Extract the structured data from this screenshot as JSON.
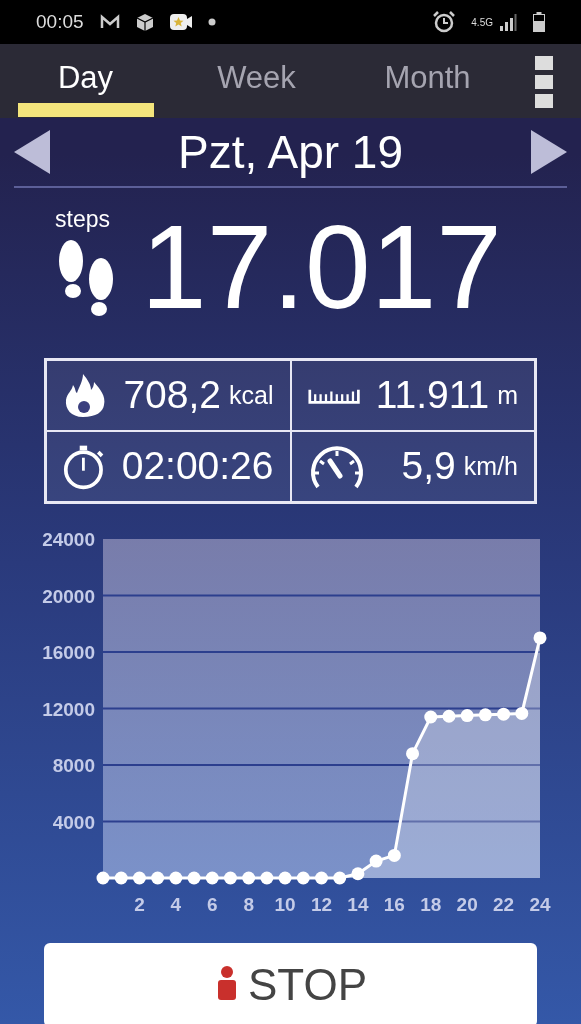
{
  "status_bar": {
    "time": "00:05",
    "network": "4.5G"
  },
  "tabs": [
    {
      "label": "Day",
      "selected": true
    },
    {
      "label": "Week",
      "selected": false
    },
    {
      "label": "Month",
      "selected": false
    }
  ],
  "date": {
    "label": "Pzt, Apr 19"
  },
  "steps": {
    "label": "steps",
    "value": "17.017"
  },
  "stats": [
    {
      "kind": "calories",
      "value": "708,2",
      "unit": "kcal"
    },
    {
      "kind": "distance",
      "value": "11.911",
      "unit": "m"
    },
    {
      "kind": "duration",
      "value": "02:00:26"
    },
    {
      "kind": "speed",
      "value": "5,9",
      "unit": "km/h"
    }
  ],
  "chart": {
    "chart_data": {
      "type": "area",
      "x": [
        0,
        1,
        2,
        3,
        4,
        5,
        6,
        7,
        8,
        9,
        10,
        11,
        12,
        13,
        14,
        15,
        16,
        17,
        18,
        19,
        20,
        21,
        22,
        23,
        24
      ],
      "series": [
        {
          "color": "#ffffff",
          "values": [
            0,
            0,
            0,
            0,
            0,
            0,
            0,
            0,
            0,
            0,
            0,
            0,
            0,
            0,
            300,
            1200,
            1600,
            8800,
            11400,
            11450,
            11500,
            11550,
            11600,
            11650,
            17000
          ]
        }
      ],
      "grid": true,
      "xlim": [
        0,
        24
      ],
      "ylim": [
        0,
        24000
      ],
      "xticks": [
        2,
        4,
        6,
        8,
        10,
        12,
        14,
        16,
        18,
        20,
        22,
        24
      ],
      "yticks": [
        4000,
        8000,
        12000,
        16000,
        20000,
        24000
      ]
    }
  },
  "stop_button": {
    "label": "STOP"
  }
}
